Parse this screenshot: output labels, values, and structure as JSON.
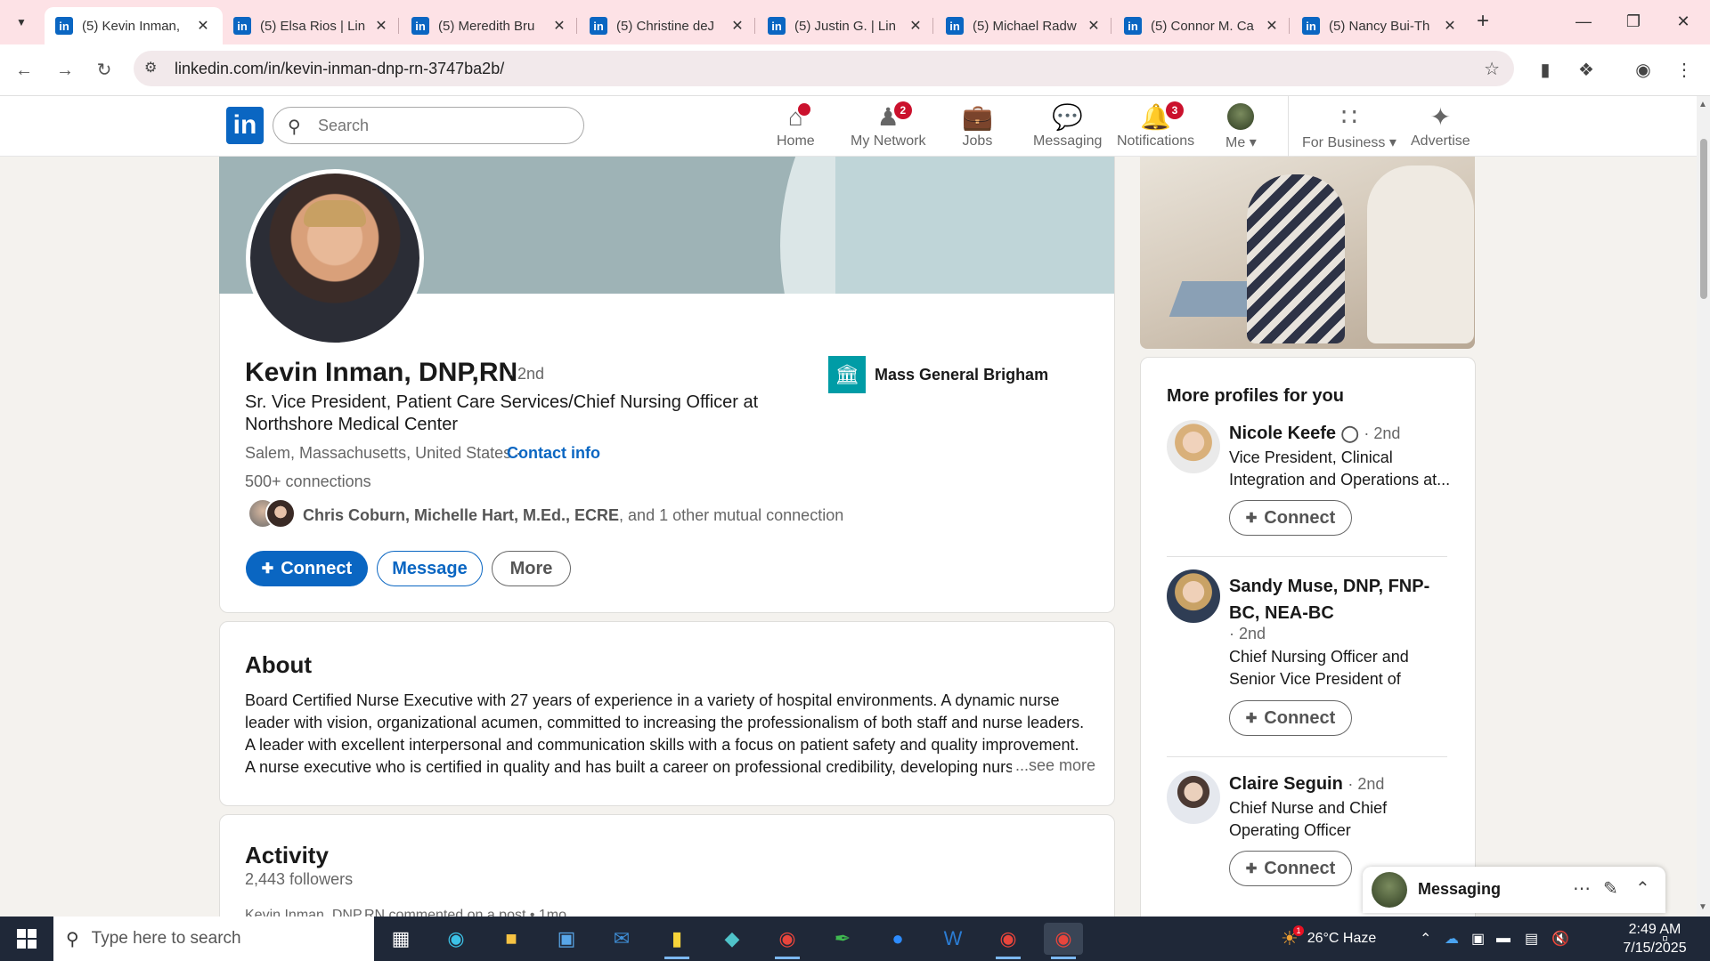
{
  "browser": {
    "tabs": [
      {
        "title": "(5) Kevin Inman,",
        "active": true
      },
      {
        "title": "(5) Elsa Rios | Lin"
      },
      {
        "title": "(5) Meredith Bru"
      },
      {
        "title": "(5) Christine deJ"
      },
      {
        "title": "(5) Justin G. | Lin"
      },
      {
        "title": "(5) Michael Radw"
      },
      {
        "title": "(5) Connor M. Ca"
      },
      {
        "title": "(5) Nancy Bui-Th"
      }
    ],
    "url": "linkedin.com/in/kevin-inman-dnp-rn-3747ba2b/"
  },
  "header": {
    "search_placeholder": "Search",
    "nav": [
      {
        "label": "Home",
        "icon": "home-icon",
        "badge": ""
      },
      {
        "label": "My Network",
        "icon": "network-icon",
        "badge": "2"
      },
      {
        "label": "Jobs",
        "icon": "briefcase-icon",
        "badge": ""
      },
      {
        "label": "Messaging",
        "icon": "messaging-icon",
        "badge": ""
      },
      {
        "label": "Notifications",
        "icon": "bell-icon",
        "badge": "3"
      },
      {
        "label": "Me",
        "icon": "avatar"
      },
      {
        "label": "For Business",
        "icon": "grid-icon"
      },
      {
        "label": "Advertise",
        "icon": "advertise-icon"
      }
    ]
  },
  "profile": {
    "name": "Kevin Inman, DNP,RN",
    "degree": "· 2nd",
    "headline": "Sr. Vice President, Patient Care Services/Chief Nursing Officer at Northshore Medical Center",
    "location": "Salem, Massachusetts, United States ·",
    "contact_info": "Contact info",
    "connections": "500+ connections",
    "mutual_names": "Chris Coburn, Michelle Hart, M.Ed., ECRE",
    "mutual_rest": ", and 1 other mutual connection",
    "company": "Mass General Brigham",
    "buttons": {
      "connect": "Connect",
      "message": "Message",
      "more": "More"
    }
  },
  "about": {
    "title": "About",
    "text": "Board Certified Nurse Executive with 27 years of experience in a variety of hospital environments. A dynamic nurse leader with vision, organizational acumen, committed to increasing the professionalism of both staff and nurse leaders. A leader with excellent interpersonal and communication skills with a focus on patient safety and quality improvement. A nurse executive who is certified in quality and has built a career on professional credibility, developing nurse leaders,",
    "see_more": "...see more"
  },
  "activity": {
    "title": "Activity",
    "followers": "2,443 followers",
    "first_line": "Kevin Inman, DNP,RN commented on a post • 1mo"
  },
  "more_profiles": {
    "title": "More profiles for you",
    "connect_label": "Connect",
    "items": [
      {
        "name": "Nicole Keefe",
        "degree": "· 2nd",
        "verified": true,
        "subtitle": "Vice President, Clinical Integration and Operations at..."
      },
      {
        "name": "Sandy Muse, DNP, FNP-BC, NEA-BC",
        "degree": "· 2nd",
        "subtitle": "Chief Nursing Officer and Senior Vice President of Patie..."
      },
      {
        "name": "Claire Seguin",
        "degree": "· 2nd",
        "subtitle": "Chief Nurse and Chief Operating Officer"
      }
    ]
  },
  "messaging": {
    "label": "Messaging"
  },
  "taskbar": {
    "search_placeholder": "Type here to search",
    "weather": "26°C  Haze",
    "time": "2:49 AM",
    "date": "7/15/2025",
    "weather_badge": "1"
  },
  "colors": {
    "linkedin_blue": "#0a66c2",
    "badge_red": "#cb112d"
  }
}
